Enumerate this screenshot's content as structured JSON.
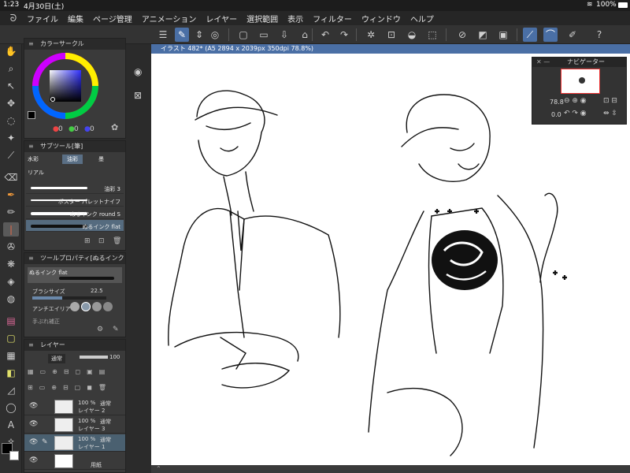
{
  "status": {
    "time": "1:23",
    "date": "4月30日(土)",
    "battery": "100%"
  },
  "menu": [
    "ファイル",
    "編集",
    "ページ管理",
    "アニメーション",
    "レイヤー",
    "選択範囲",
    "表示",
    "フィルター",
    "ウィンドウ",
    "ヘルプ"
  ],
  "panels": {
    "color": {
      "title": "カラーサークル",
      "values": [
        "0",
        "0",
        "0"
      ]
    },
    "subtool": {
      "title": "サブツール[筆]",
      "tabs": [
        "水彩",
        "油彩",
        "墨"
      ],
      "tab2": "リアル",
      "brushes": [
        "油彩 3",
        "ポスター パレットナイフ",
        "ぬるインク round S",
        "ぬるインク flat"
      ]
    },
    "toolprop": {
      "title": "ツールプロパティ[ぬるインク",
      "brush_name": "ぬるインク flat",
      "size_label": "ブラシサイズ",
      "size_value": "22.5",
      "aa_label": "アンチエイリア",
      "extra_label": "手ぶれ補正"
    },
    "layers": {
      "title": "レイヤー",
      "blend": "通常",
      "opacity": "100",
      "rows": [
        {
          "pct": "100 %",
          "mode": "通常",
          "name": "レイヤー 2"
        },
        {
          "pct": "100 %",
          "mode": "通常",
          "name": "レイヤー 3"
        },
        {
          "pct": "100 %",
          "mode": "通常",
          "name": "レイヤー 1"
        },
        {
          "pct": "",
          "mode": "",
          "name": "用紙"
        }
      ]
    }
  },
  "canvas": {
    "tab_title": "イラスト 482* (A5 2894 x 2039px 350dpi 78.8%)"
  },
  "navigator": {
    "title": "ナビゲーター",
    "zoom": "78.8",
    "angle": "0.0"
  }
}
